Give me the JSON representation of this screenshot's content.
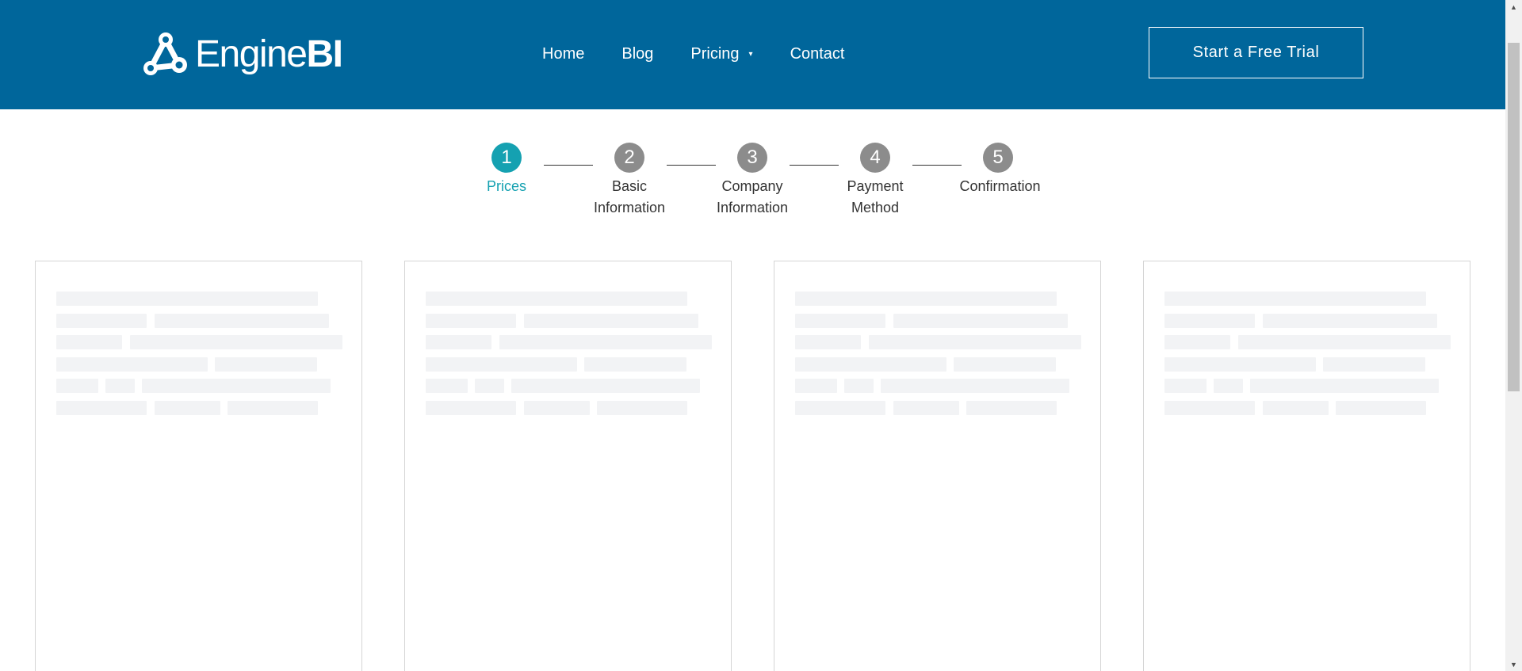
{
  "header": {
    "logo": {
      "light": "Engine",
      "bold": "BI"
    },
    "nav": [
      {
        "label": "Home"
      },
      {
        "label": "Blog"
      },
      {
        "label": "Pricing",
        "has_dropdown": true,
        "caret": "▾"
      },
      {
        "label": "Contact"
      }
    ],
    "cta_label": "Start a Free Trial"
  },
  "stepper": {
    "active_step": 1,
    "steps": [
      {
        "number": "1",
        "label": "Prices"
      },
      {
        "number": "2",
        "label": "Basic Information"
      },
      {
        "number": "3",
        "label": "Company Information"
      },
      {
        "number": "4",
        "label": "Payment Method"
      },
      {
        "number": "5",
        "label": "Confirmation"
      }
    ]
  },
  "cards": {
    "count": 4,
    "state": "loading-skeleton"
  },
  "colors": {
    "header_bg": "#00669b",
    "active_step": "#15a1b1",
    "inactive_step": "#8c8c8c",
    "skeleton": "#f2f3f5",
    "card_border": "#d5d5d5"
  },
  "scrollbar": {
    "up_arrow": "▲",
    "down_arrow": "▼"
  }
}
